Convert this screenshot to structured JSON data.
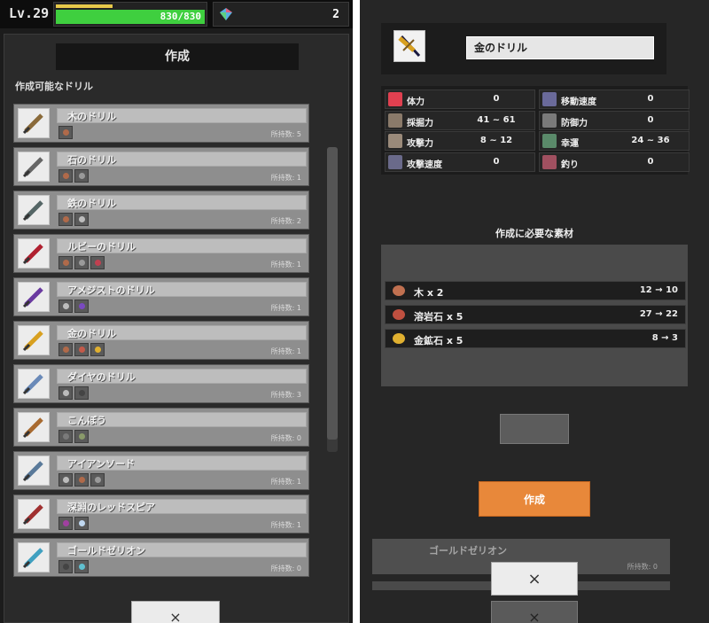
{
  "player": {
    "level": "Lv.29",
    "hp_text": "830/830",
    "hp_fraction": 1.0,
    "exp_fraction": 0.38,
    "gems": "2"
  },
  "craft": {
    "title": "作成",
    "subtitle": "作成可能なドリル",
    "close": "×"
  },
  "items": [
    {
      "name": "木のドリル",
      "owned": "所持数: 5",
      "mats": [
        "#b06a4a"
      ],
      "color": "#8a6a3a"
    },
    {
      "name": "石のドリル",
      "owned": "所持数: 1",
      "mats": [
        "#b06a4a",
        "#9a9a9a"
      ],
      "color": "#666"
    },
    {
      "name": "鉄のドリル",
      "owned": "所持数: 2",
      "mats": [
        "#b06a4a",
        "#bcbcbc"
      ],
      "color": "#566"
    },
    {
      "name": "ルビーのドリル",
      "owned": "所持数: 1",
      "mats": [
        "#b06a4a",
        "#9a9a9a",
        "#c04050"
      ],
      "color": "#b02030"
    },
    {
      "name": "アメジストのドリル",
      "owned": "所持数: 1",
      "mats": [
        "#bcbcbc",
        "#7a4ac0"
      ],
      "color": "#6a3aa0"
    },
    {
      "name": "金のドリル",
      "owned": "所持数: 1",
      "mats": [
        "#b06a4a",
        "#c45a4a",
        "#e0b030"
      ],
      "color": "#d8a020"
    },
    {
      "name": "ダイヤのドリル",
      "owned": "所持数: 3",
      "mats": [
        "#bcbcbc",
        "#444"
      ],
      "color": "#6a8ab8"
    },
    {
      "name": "こんぼう",
      "owned": "所持数: 0",
      "mats": [
        "#7a7a7a",
        "#8a9a6a"
      ],
      "color": "#a86a30"
    },
    {
      "name": "アイアンソード",
      "owned": "所持数: 1",
      "mats": [
        "#bcbcbc",
        "#b06a4a",
        "#9a9a9a"
      ],
      "color": "#5a7a9a"
    },
    {
      "name": "深淵のレッドスピア",
      "owned": "所持数: 1",
      "mats": [
        "#a040a0",
        "#c0d8f0"
      ],
      "color": "#a03030"
    },
    {
      "name": "ゴールドゼリオン",
      "owned": "所持数: 0",
      "mats": [
        "#444",
        "#60c0d0"
      ],
      "color": "#40a0c0"
    }
  ],
  "detail": {
    "name": "金のドリル",
    "req_title": "作成に必要な素材",
    "craft_label": "作成",
    "close": "×"
  },
  "stats": [
    {
      "label": "体力",
      "value": "0",
      "color": "#e04050"
    },
    {
      "label": "移動速度",
      "value": "0",
      "color": "#6a6a9a"
    },
    {
      "label": "採掘力",
      "value": "41 ~ 61",
      "color": "#8a7a6a"
    },
    {
      "label": "防御力",
      "value": "0",
      "color": "#7a7a7a"
    },
    {
      "label": "攻撃力",
      "value": "8 ~ 12",
      "color": "#9a8a7a"
    },
    {
      "label": "幸運",
      "value": "24 ~ 36",
      "color": "#5a8a6a"
    },
    {
      "label": "攻撃速度",
      "value": "0",
      "color": "#6a6a8a"
    },
    {
      "label": "釣り",
      "value": "0",
      "color": "#a05060"
    }
  ],
  "requirements": [
    {
      "name": "木 x 2",
      "counts": "12 → 10",
      "color": "#c07050"
    },
    {
      "name": "溶岩石 x 5",
      "counts": "27 → 22",
      "color": "#c05040"
    },
    {
      "name": "金鉱石 x 5",
      "counts": "8 → 3",
      "color": "#e0b030"
    }
  ],
  "background": {
    "name": "ゴールドゼリオン",
    "owned": "所持数: 0"
  }
}
